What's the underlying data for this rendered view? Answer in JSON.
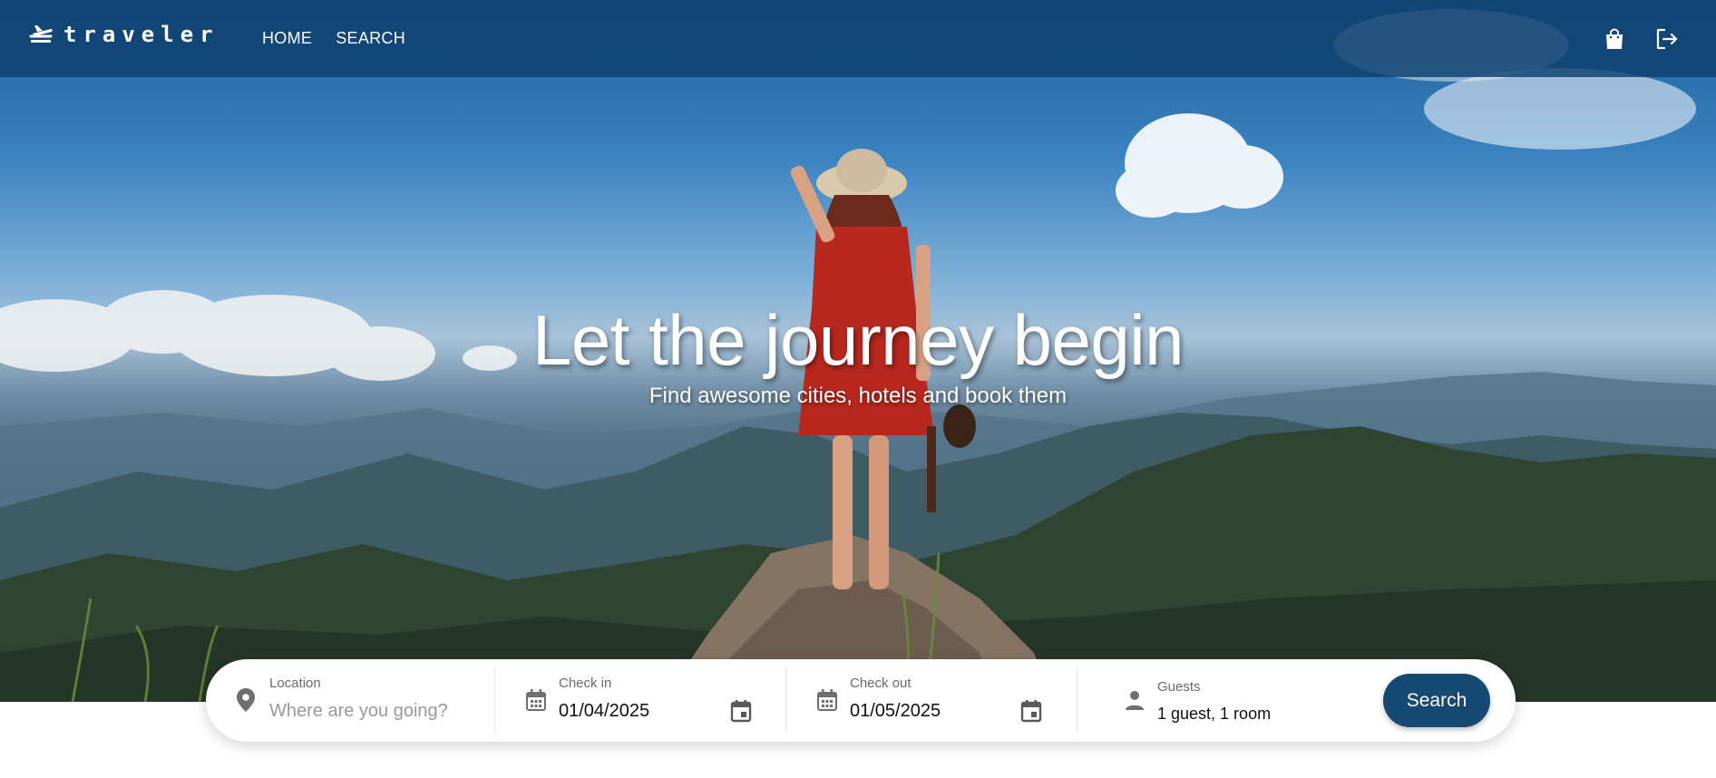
{
  "header": {
    "brand": "traveler",
    "nav": [
      {
        "label": "HOME"
      },
      {
        "label": "SEARCH"
      }
    ],
    "icons": [
      "shopping-bag-icon",
      "logout-icon"
    ]
  },
  "hero": {
    "title": "Let the journey begin",
    "subtitle": "Find awesome cities, hotels and book them"
  },
  "search": {
    "location": {
      "label": "Location",
      "placeholder": "Where are you going?",
      "value": ""
    },
    "check_in": {
      "label": "Check in",
      "value": "01/04/2025"
    },
    "check_out": {
      "label": "Check out",
      "value": "01/05/2025"
    },
    "guests": {
      "label": "Guests",
      "value": "1 guest, 1 room"
    },
    "button_label": "Search"
  },
  "colors": {
    "header_bg": "#0e3f6e",
    "button_bg": "#174a72",
    "text_primary": "#111111",
    "label_gray": "#6b6b6b"
  }
}
